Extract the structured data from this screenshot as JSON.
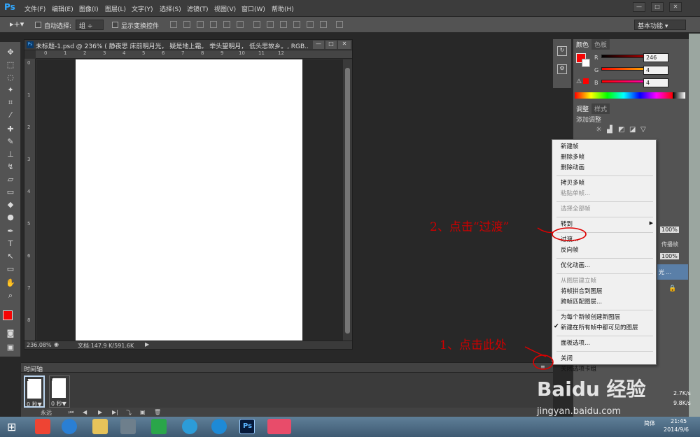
{
  "app": {
    "logo": "Ps",
    "menus": [
      "文件(F)",
      "编辑(E)",
      "图像(I)",
      "图层(L)",
      "文字(Y)",
      "选择(S)",
      "滤镜(T)",
      "视图(V)",
      "窗口(W)",
      "帮助(H)"
    ],
    "window_buttons": [
      "—",
      "□",
      "✕"
    ]
  },
  "options_bar": {
    "auto_select_label": "自动选择:",
    "auto_select_value": "组",
    "show_transform_label": "显示变换控件",
    "workspace": "基本功能"
  },
  "document": {
    "title": "未标题-1.psd @ 236% (   静夜思 床前明月光， 疑是地上霜。 举头望明月， 低头思故乡。, RGB...",
    "zoom": "236.08%",
    "doc_info": "文档:147.9 K/591.6K",
    "ruler_h_labels": [
      "0",
      "1",
      "2",
      "3",
      "4",
      "5",
      "6",
      "7",
      "8",
      "9",
      "10",
      "11",
      "12"
    ],
    "ruler_v_labels": [
      "0",
      "1",
      "2",
      "3",
      "4",
      "5",
      "6",
      "7",
      "8"
    ]
  },
  "color_panel": {
    "tabs": [
      "颜色",
      "色板"
    ],
    "channels": [
      {
        "label": "R",
        "value": "246",
        "color": "#f60404"
      },
      {
        "label": "G",
        "value": "4",
        "color": "#04ff04"
      },
      {
        "label": "B",
        "value": "4",
        "color": "#0404ff"
      }
    ],
    "foreground": "#f60404"
  },
  "adjust_panel": {
    "tabs": [
      "调整",
      "样式"
    ],
    "add_label": "添加调整"
  },
  "layers_panel": {
    "opacity": "100%",
    "fill": "100%",
    "propagate": "传播帧",
    "layer_text": "光 ..."
  },
  "context_menu": {
    "items": [
      {
        "label": "新建帧",
        "disabled": false
      },
      {
        "label": "删除多帧",
        "disabled": false
      },
      {
        "label": "删除动画",
        "disabled": false
      },
      {
        "sep": true
      },
      {
        "label": "拷贝多帧",
        "disabled": false
      },
      {
        "label": "粘贴单帧...",
        "disabled": true
      },
      {
        "sep": true
      },
      {
        "label": "选择全部帧",
        "disabled": true
      },
      {
        "sep": true
      },
      {
        "label": "转到",
        "disabled": false,
        "submenu": true
      },
      {
        "sep": true
      },
      {
        "label": "过渡...",
        "disabled": false
      },
      {
        "label": "反向帧",
        "disabled": false
      },
      {
        "sep": true
      },
      {
        "label": "优化动画...",
        "disabled": false
      },
      {
        "sep": true
      },
      {
        "label": "从图层建立帧",
        "disabled": true
      },
      {
        "label": "将帧拼合到图层",
        "disabled": false
      },
      {
        "label": "跨帧匹配图层...",
        "disabled": false
      },
      {
        "sep": true
      },
      {
        "label": "为每个新帧创建新图层",
        "disabled": false
      },
      {
        "label": "新建在所有帧中都可见的图层",
        "disabled": false,
        "checked": true
      },
      {
        "sep": true
      },
      {
        "label": "面板选项...",
        "disabled": false
      },
      {
        "sep": true
      },
      {
        "label": "关闭",
        "disabled": false
      },
      {
        "label": "关闭选项卡组",
        "disabled": false
      }
    ]
  },
  "timeline": {
    "title": "时间轴",
    "frames": [
      {
        "num": "1",
        "delay": "0 秒▼"
      },
      {
        "num": "2",
        "delay": "0 秒▼"
      }
    ],
    "loop": "永远"
  },
  "annotations": {
    "step1": "1、点击此处",
    "step2": "2、点击“过渡”"
  },
  "taskbar": {
    "time": "21:45",
    "date": "2014/9/6",
    "ime": "简体",
    "net_up": "2.7K/s",
    "net_down": "9.8K/s"
  },
  "watermark": {
    "brand": "Baidu 经验",
    "url": "jingyan.baidu.com"
  }
}
